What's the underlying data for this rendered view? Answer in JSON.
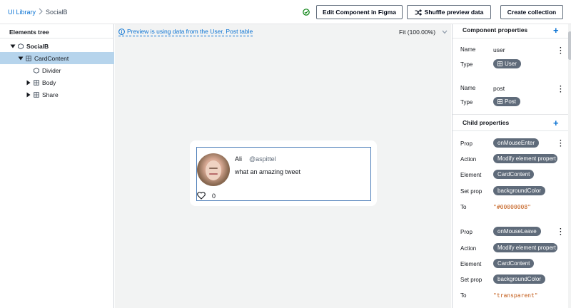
{
  "breadcrumb": {
    "root": "UI Library",
    "current": "SocialB"
  },
  "toolbar": {
    "edit_figma": "Edit Component in Figma",
    "shuffle": "Shuffle preview data",
    "create": "Create collection"
  },
  "tree": {
    "title": "Elements tree",
    "items": [
      {
        "label": "SocialB"
      },
      {
        "label": "CardContent"
      },
      {
        "label": "Divider"
      },
      {
        "label": "Body"
      },
      {
        "label": "Share"
      }
    ]
  },
  "canvas": {
    "preview_note": "Preview is using data from the User, Post table",
    "fit": "Fit (100.00%)"
  },
  "card": {
    "name": "Ali",
    "handle": "@aspittel",
    "tweet": "what an amazing tweet",
    "likes": "0"
  },
  "component_props": {
    "title": "Component properties",
    "items": [
      {
        "name_label": "Name",
        "name": "user",
        "type_label": "Type",
        "type": "User"
      },
      {
        "name_label": "Name",
        "name": "post",
        "type_label": "Type",
        "type": "Post"
      }
    ]
  },
  "child_props": {
    "title": "Child properties",
    "items": [
      {
        "prop_label": "Prop",
        "prop": "onMouseEnter",
        "action_label": "Action",
        "action": "Modify element propert",
        "element_label": "Element",
        "element": "CardContent",
        "setprop_label": "Set prop",
        "setprop": "backgroundColor",
        "to_label": "To",
        "to": "\"#00000008\""
      },
      {
        "prop_label": "Prop",
        "prop": "onMouseLeave",
        "action_label": "Action",
        "action": "Modify element propert",
        "element_label": "Element",
        "element": "CardContent",
        "setprop_label": "Set prop",
        "setprop": "backgroundColor",
        "to_label": "To",
        "to": "\"transparent\""
      }
    ]
  },
  "colors": {
    "accent": "#0972d3",
    "pill": "#5f6b7a",
    "selected": "#b6d4ec",
    "code": "#c25a16",
    "success": "#037f0c"
  }
}
